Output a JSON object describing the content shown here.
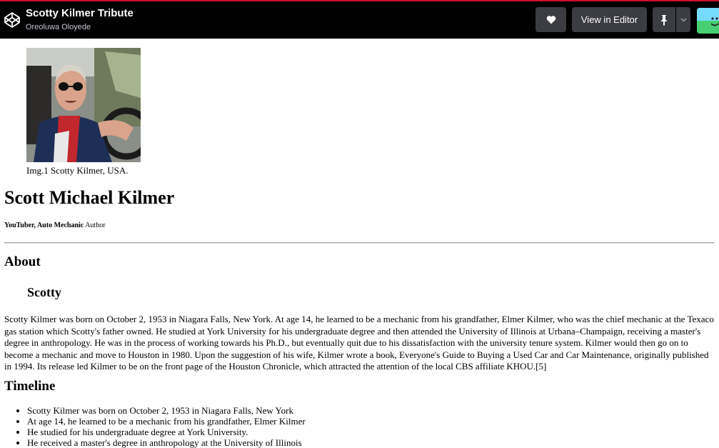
{
  "header": {
    "title": "Scotty Kilmer Tribute",
    "author": "Oreoluwa Oloyede",
    "view_in_editor": "View in Editor",
    "icons": [
      "codepen-logo-icon",
      "heart-icon",
      "pin-icon",
      "chevron-down-icon",
      "avatar"
    ],
    "accent_color": "#c8102e",
    "avatar_color": "#47cf73"
  },
  "figure": {
    "caption": "Img.1 Scotty Kilmer, USA."
  },
  "main": {
    "name": "Scott Michael Kilmer",
    "tagline_bold": "YouTuber, Auto Mechanic",
    "tagline_rest": "Author",
    "about_heading": "About",
    "scotty_heading": "Scotty",
    "bio": "Scotty Kilmer was born on October 2, 1953 in Niagara Falls, New York. At age 14, he learned to be a mechanic from his grandfather, Elmer Kilmer, who was the chief mechanic at the Texaco gas station which Scotty's father owned. He studied at York University for his undergraduate degree and then attended the University of Illinois at Urbana–Champaign, receiving a master's degree in anthropology. He was in the process of working towards his Ph.D., but eventually quit due to his dissatisfaction with the university tenure system. Kilmer would then go on to become a mechanic and move to Houston in 1980. Upon the suggestion of his wife, Kilmer wrote a book, Everyone's Guide to Buying a Used Car and Car Maintenance, originally published in 1994. Its release led Kilmer to be on the front page of the Houston Chronicle, which attracted the attention of the local CBS affiliate KHOU.[5]",
    "timeline_heading": "Timeline",
    "timeline": [
      "Scotty Kilmer was born on October 2, 1953 in Niagara Falls, New York",
      "At age 14, he learned to be a mechanic from his grandfather, Elmer Kilmer",
      "He studied for his undergraduate degree at York University.",
      "He received a master's degree in anthropology at the University of Illinois"
    ]
  }
}
